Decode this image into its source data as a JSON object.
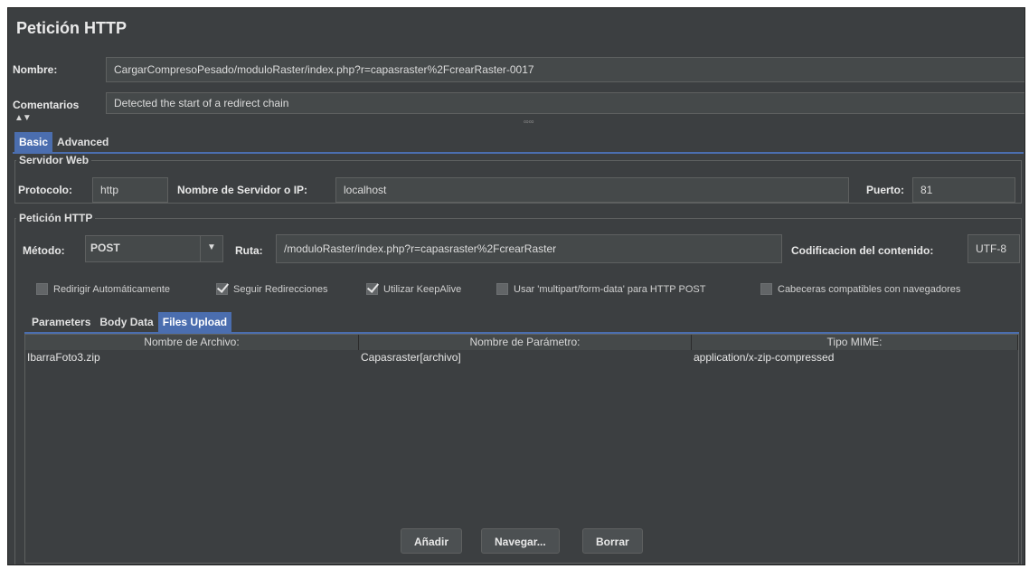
{
  "panel": {
    "title": "Petición HTTP",
    "name_label": "Nombre:",
    "name_value": "CargarCompresoPesado/moduloRaster/index.php?r=capasraster%2FcrearRaster-0017",
    "comments_label": "Comentarios",
    "comments_value": "Detected the start of a redirect chain",
    "collapse_icon": "▲▼",
    "splitter_dots": "∞∞"
  },
  "tabs": [
    {
      "label": "Basic",
      "selected": true
    },
    {
      "label": "Advanced",
      "selected": false
    }
  ],
  "server": {
    "group_title": "Servidor Web",
    "protocol_label": "Protocolo:",
    "protocol_value": "http",
    "host_label": "Nombre de Servidor o IP:",
    "host_value": "localhost",
    "port_label": "Puerto:",
    "port_value": "81"
  },
  "request": {
    "group_title": "Petición HTTP",
    "method_label": "Método:",
    "method_value": "POST",
    "path_label": "Ruta:",
    "path_value": "/moduloRaster/index.php?r=capasraster%2FcrearRaster",
    "encoding_label": "Codificacion del contenido:",
    "encoding_value": "UTF-8"
  },
  "options": [
    {
      "label": "Redirigir Automáticamente",
      "checked": false
    },
    {
      "label": "Seguir Redirecciones",
      "checked": true
    },
    {
      "label": "Utilizar KeepAlive",
      "checked": true
    },
    {
      "label": "Usar 'multipart/form-data' para HTTP POST",
      "checked": false
    },
    {
      "label": "Cabeceras compatibles con navegadores",
      "checked": false
    }
  ],
  "subtabs": [
    {
      "label": "Parameters",
      "selected": false
    },
    {
      "label": "Body Data",
      "selected": false
    },
    {
      "label": "Files Upload",
      "selected": true
    }
  ],
  "files_table": {
    "columns": [
      "Nombre de Archivo:",
      "Nombre de Parámetro:",
      "Tipo MIME:"
    ],
    "rows": [
      [
        "IbarraFoto3.zip",
        "Capasraster[archivo]",
        "application/x-zip-compressed"
      ]
    ]
  },
  "buttons": {
    "add": "Añadir",
    "browse": "Navegar...",
    "delete": "Borrar"
  },
  "colors": {
    "background": "#3c3f41",
    "field": "#45494a",
    "selected_tab": "#4b6eaf"
  }
}
